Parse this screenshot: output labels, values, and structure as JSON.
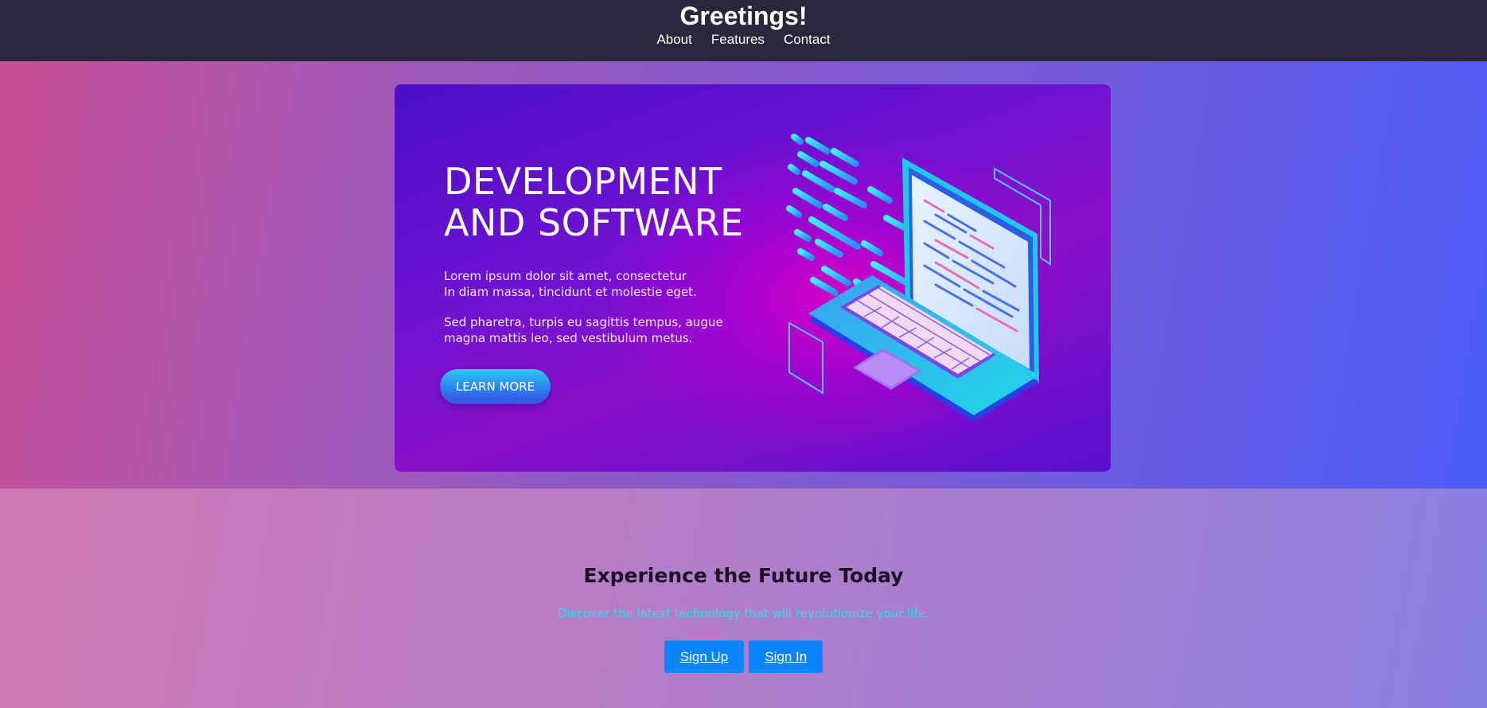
{
  "header": {
    "title": "Greetings!",
    "nav": [
      {
        "label": "About"
      },
      {
        "label": "Features"
      },
      {
        "label": "Contact"
      }
    ]
  },
  "banner": {
    "heading_line1": "DEVELOPMENT",
    "heading_line2": "AND SOFTWARE",
    "paragraph1_line1": "Lorem ipsum dolor sit amet, consectetur",
    "paragraph1_line2": "In diam massa, tincidunt et molestie eget.",
    "paragraph2_line1": "Sed pharetra, turpis eu sagittis tempus, augue",
    "paragraph2_line2": "magna mattis leo, sed vestibulum metus.",
    "button_label": "LEARN MORE",
    "illustration_icon": "laptop-code-icon"
  },
  "promo": {
    "title": "Experience the Future Today",
    "subtitle": "Discover the latest technology that will revolutionize your life.",
    "signup_label": "Sign Up",
    "signin_label": "Sign In"
  },
  "colors": {
    "header_bg": "#2a273c",
    "cta_blue": "#0a84ff",
    "subtitle_cyan": "#19e4f0"
  }
}
